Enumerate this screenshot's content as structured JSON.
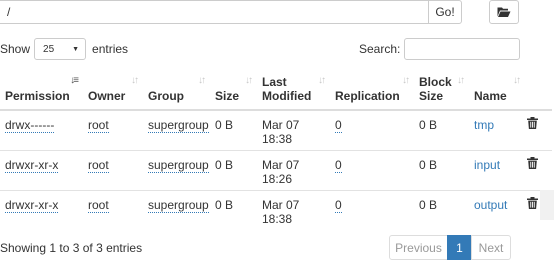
{
  "path_bar": {
    "value": "/",
    "go_label": "Go!"
  },
  "show": {
    "prefix": "Show",
    "selected": "25",
    "suffix": "entries"
  },
  "search": {
    "label": "Search:",
    "value": ""
  },
  "columns": [
    {
      "label": "Permission"
    },
    {
      "label": "Owner"
    },
    {
      "label": "Group"
    },
    {
      "label": "Size"
    },
    {
      "label": "Last Modified"
    },
    {
      "label": "Replication"
    },
    {
      "label": "Block Size"
    },
    {
      "label": "Name"
    }
  ],
  "rows": [
    {
      "permission": "drwx------",
      "owner": "root",
      "group": "supergroup",
      "size": "0 B",
      "modified_line1": "Mar 07",
      "modified_line2": "18:38",
      "replication": "0",
      "block_size": "0 B",
      "name": "tmp"
    },
    {
      "permission": "drwxr-xr-x",
      "owner": "root",
      "group": "supergroup",
      "size": "0 B",
      "modified_line1": "Mar 07",
      "modified_line2": "18:26",
      "replication": "0",
      "block_size": "0 B",
      "name": "input"
    },
    {
      "permission": "drwxr-xr-x",
      "owner": "root",
      "group": "supergroup",
      "size": "0 B",
      "modified_line1": "Mar 07",
      "modified_line2": "18:38",
      "replication": "0",
      "block_size": "0 B",
      "name": "output"
    }
  ],
  "footer": {
    "info": "Showing 1 to 3 of 3 entries"
  },
  "pagination": {
    "previous": "Previous",
    "current": "1",
    "next": "Next"
  },
  "colors": {
    "link": "#337ab7",
    "active_page": "#337ab7",
    "border": "#dddddd"
  },
  "icons": {
    "browse": "folder-open-icon",
    "delete": "trash-icon",
    "sort": "sort-icon"
  }
}
